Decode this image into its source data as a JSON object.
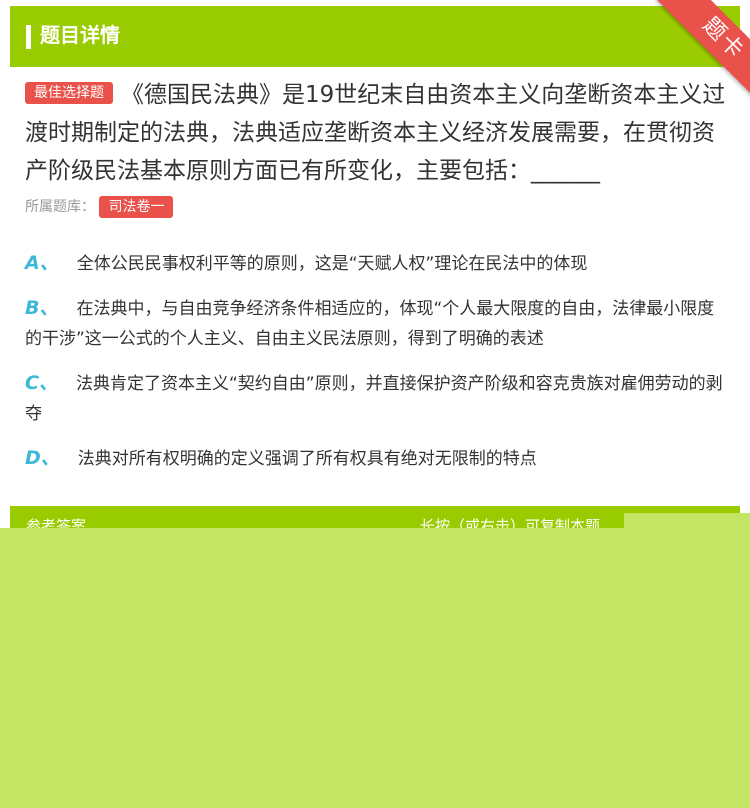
{
  "header": {
    "title": "题目详情",
    "corner_badge": "题卡"
  },
  "question": {
    "tag": "最佳选择题",
    "text": "《德国民法典》是19世纪末自由资本主义向垄断资本主义过渡时期制定的法典，法典适应垄断资本主义经济发展需要，在贯彻资产阶级民法基本原则方面已有所变化，主要包括：______",
    "source_label": "所属题库：",
    "source_value": "司法卷一"
  },
  "options": [
    {
      "letter": "A、",
      "text": "全体公民民事权利平等的原则，这是“天赋人权”理论在民法中的体现"
    },
    {
      "letter": "B、",
      "text": "在法典中，与自由竞争经济条件相适应的，体现“个人最大限度的自由，法律最小限度的干涉”这一公式的个人主义、自由主义民法原则，得到了明确的表述"
    },
    {
      "letter": "C、",
      "text": "法典肯定了资本主义“契约自由”原则，并直接保护资产阶级和容克贵族对雇佣劳动的剥夺"
    },
    {
      "letter": "D、",
      "text": "法典对所有权明确的定义强调了所有权具有绝对无限制的特点"
    }
  ],
  "answer": {
    "label": "参考答案",
    "copy_hint": "长按（或右击）可复制本题"
  },
  "colors": {
    "brand_green": "#99cc00",
    "badge_red": "#e9524a",
    "option_letter_blue": "#3cb8d8",
    "overlay_green": "#c4e563"
  }
}
